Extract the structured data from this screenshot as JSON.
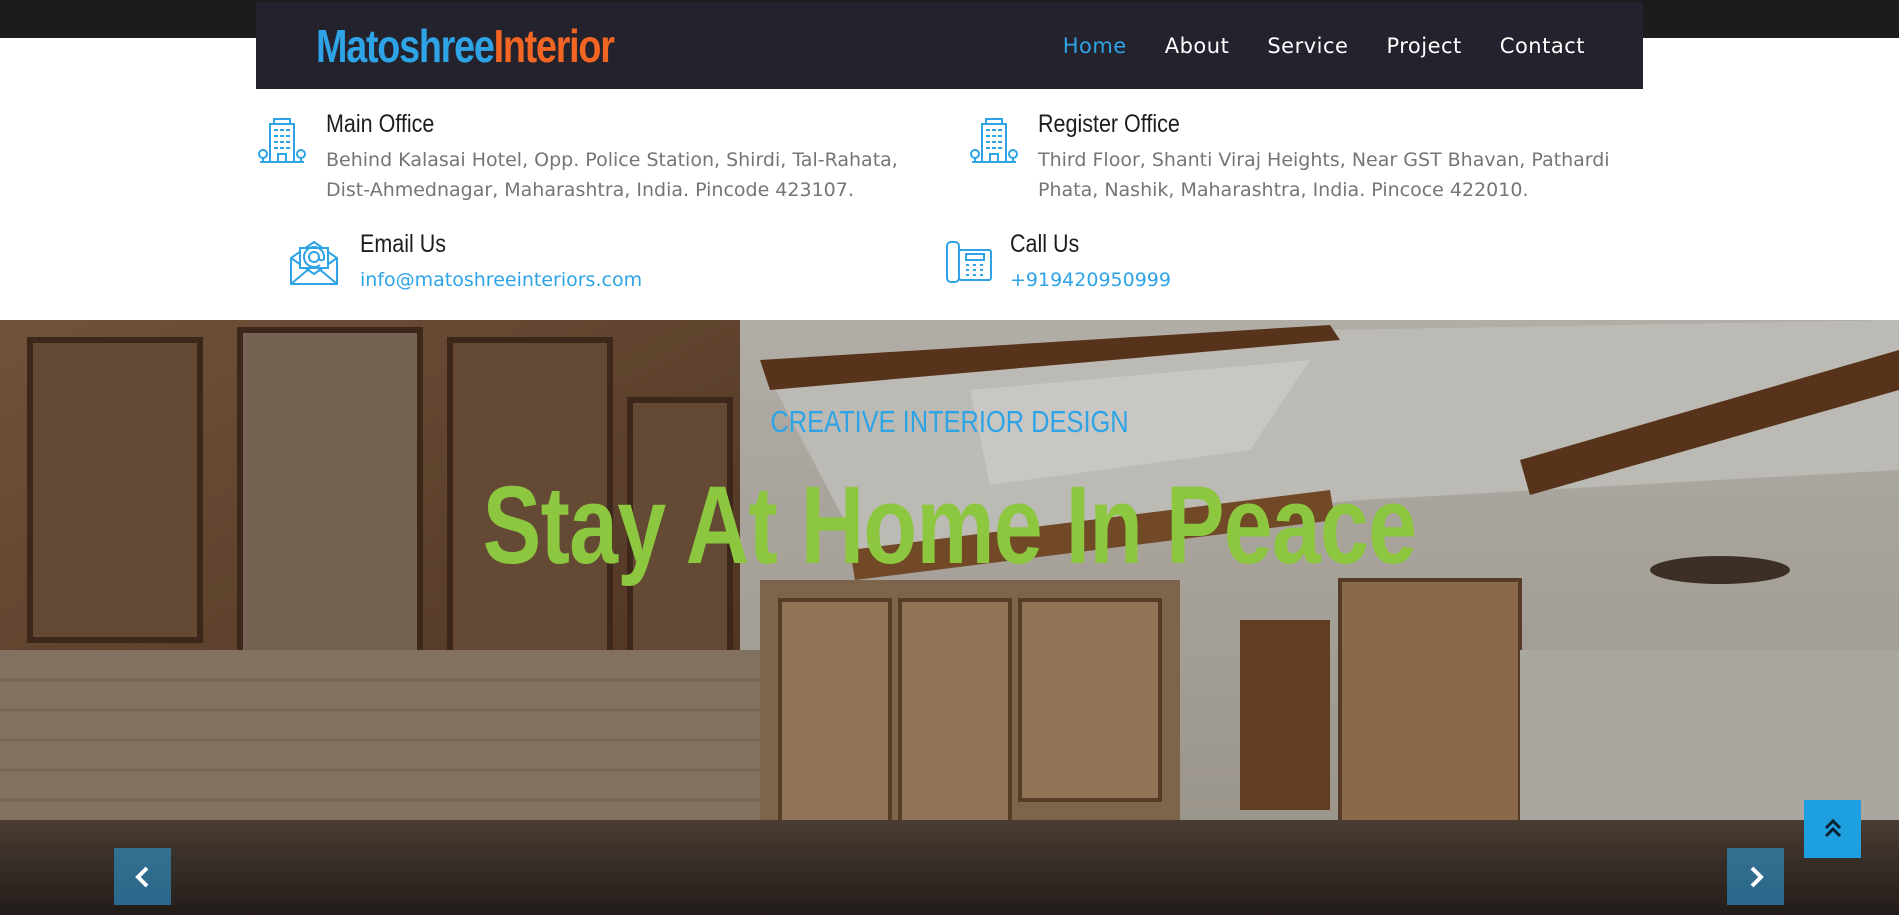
{
  "brand": {
    "part1": "Matoshree",
    "part2": "Interior",
    "color1": "#2ea3e6",
    "color2": "#f26522"
  },
  "nav": {
    "items": [
      {
        "label": "Home",
        "active": true
      },
      {
        "label": "About"
      },
      {
        "label": "Service"
      },
      {
        "label": "Project"
      },
      {
        "label": "Contact"
      }
    ]
  },
  "contacts": {
    "main_office": {
      "title": "Main Office",
      "line1": "Behind Kalasai Hotel, Opp. Police Station, Shirdi, Tal-Rahata,",
      "line2": "Dist-Ahmednagar, Maharashtra, India. Pincode 423107.",
      "icon": "building-icon"
    },
    "register_office": {
      "title": "Register Office",
      "line1": "Third Floor, Shanti Viraj Heights, Near GST Bhavan, Pathardi",
      "line2": "Phata, Nashik, Maharashtra, India. Pincoce 422010.",
      "icon": "building-icon"
    },
    "email": {
      "title": "Email Us",
      "value": "info@matoshreeinteriors.com",
      "icon": "envelope-icon"
    },
    "phone": {
      "title": "Call Us",
      "value": "+919420950999",
      "icon": "telephone-icon"
    }
  },
  "hero": {
    "subtitle": "CREATIVE INTERIOR DESIGN",
    "title": "Stay At Home In Peace",
    "subtitle_color": "#2ea3e6",
    "title_color": "#8dc63f"
  },
  "controls": {
    "prev_icon": "chevron-left-icon",
    "next_icon": "chevron-right-icon",
    "scroll_top_icon": "double-chevron-up-icon"
  }
}
